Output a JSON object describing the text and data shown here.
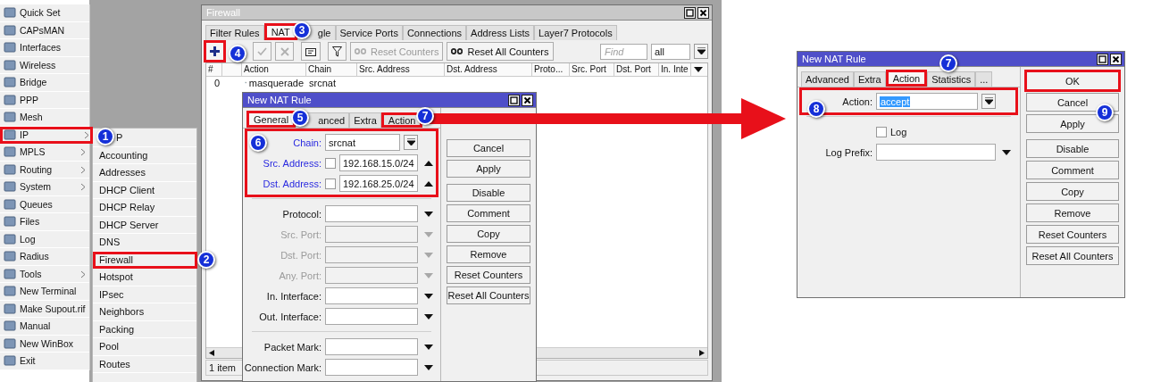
{
  "menu": {
    "items": [
      {
        "label": "Quick Set",
        "has_submenu": false,
        "highlighted": false
      },
      {
        "label": "CAPsMAN",
        "has_submenu": false,
        "highlighted": false
      },
      {
        "label": "Interfaces",
        "has_submenu": false,
        "highlighted": false
      },
      {
        "label": "Wireless",
        "has_submenu": false,
        "highlighted": false
      },
      {
        "label": "Bridge",
        "has_submenu": false,
        "highlighted": false
      },
      {
        "label": "PPP",
        "has_submenu": false,
        "highlighted": false
      },
      {
        "label": "Mesh",
        "has_submenu": false,
        "highlighted": false
      },
      {
        "label": "IP",
        "has_submenu": true,
        "highlighted": true
      },
      {
        "label": "MPLS",
        "has_submenu": true,
        "highlighted": false
      },
      {
        "label": "Routing",
        "has_submenu": true,
        "highlighted": false
      },
      {
        "label": "System",
        "has_submenu": true,
        "highlighted": false
      },
      {
        "label": "Queues",
        "has_submenu": false,
        "highlighted": false
      },
      {
        "label": "Files",
        "has_submenu": false,
        "highlighted": false
      },
      {
        "label": "Log",
        "has_submenu": false,
        "highlighted": false
      },
      {
        "label": "Radius",
        "has_submenu": false,
        "highlighted": false
      },
      {
        "label": "Tools",
        "has_submenu": true,
        "highlighted": false
      },
      {
        "label": "New Terminal",
        "has_submenu": false,
        "highlighted": false
      },
      {
        "label": "Make Supout.rif",
        "has_submenu": false,
        "highlighted": false
      },
      {
        "label": "Manual",
        "has_submenu": false,
        "highlighted": false
      },
      {
        "label": "New WinBox",
        "has_submenu": false,
        "highlighted": false
      },
      {
        "label": "Exit",
        "has_submenu": false,
        "highlighted": false
      }
    ]
  },
  "submenu": {
    "items": [
      {
        "label": "P",
        "highlighted": false
      },
      {
        "label": "Accounting",
        "highlighted": false
      },
      {
        "label": "Addresses",
        "highlighted": false
      },
      {
        "label": "DHCP Client",
        "highlighted": false
      },
      {
        "label": "DHCP Relay",
        "highlighted": false
      },
      {
        "label": "DHCP Server",
        "highlighted": false
      },
      {
        "label": "DNS",
        "highlighted": false
      },
      {
        "label": "Firewall",
        "highlighted": true
      },
      {
        "label": "Hotspot",
        "highlighted": false
      },
      {
        "label": "IPsec",
        "highlighted": false
      },
      {
        "label": "Neighbors",
        "highlighted": false
      },
      {
        "label": "Packing",
        "highlighted": false
      },
      {
        "label": "Pool",
        "highlighted": false
      },
      {
        "label": "Routes",
        "highlighted": false
      }
    ]
  },
  "firewall": {
    "title": "Firewall",
    "tabs": [
      {
        "label": "Filter Rules",
        "selected": false,
        "highlighted": false
      },
      {
        "label": "NAT",
        "selected": true,
        "highlighted": true
      },
      {
        "label": "gle",
        "selected": false,
        "highlighted": false
      },
      {
        "label": "Service Ports",
        "selected": false,
        "highlighted": false
      },
      {
        "label": "Connections",
        "selected": false,
        "highlighted": false
      },
      {
        "label": "Address Lists",
        "selected": false,
        "highlighted": false
      },
      {
        "label": "Layer7 Protocols",
        "selected": false,
        "highlighted": false
      }
    ],
    "toolbar": [
      {
        "kind": "add",
        "disabled": false,
        "highlighted": true
      },
      {
        "kind": "enable",
        "disabled": true,
        "highlighted": false
      },
      {
        "kind": "disable",
        "disabled": true,
        "highlighted": false
      },
      {
        "kind": "comment",
        "disabled": false,
        "highlighted": false
      },
      {
        "kind": "filter",
        "disabled": false,
        "highlighted": false
      },
      {
        "kind": "text",
        "label": "Reset Counters",
        "disabled": true,
        "highlighted": false
      },
      {
        "kind": "text",
        "label": "Reset All Counters",
        "disabled": false,
        "highlighted": false
      }
    ],
    "find": {
      "placeholder": "Find"
    },
    "filter_select": {
      "value": "all"
    },
    "table": {
      "columns": [
        "#",
        "Action",
        "Chain",
        "Src. Address",
        "Dst. Address",
        "Proto...",
        "Src. Port",
        "Dst. Port",
        "In. Inte"
      ],
      "rows": [
        {
          "number": "0",
          "action": "masquerade",
          "chain": "srcnat"
        }
      ]
    },
    "status": "1 item"
  },
  "nat_dialog": {
    "title": "New NAT Rule",
    "tabs": [
      {
        "label": "General",
        "selected": true,
        "highlighted": true
      },
      {
        "label": "anced",
        "selected": false,
        "highlighted": false
      },
      {
        "label": "Extra",
        "selected": false,
        "highlighted": false
      },
      {
        "label": "Action",
        "selected": false,
        "highlighted": true
      }
    ],
    "groups": [
      {
        "highlighted": true,
        "fields": [
          {
            "kind": "select",
            "label": "Chain:",
            "value": "srcnat",
            "set": true,
            "disabled": false
          },
          {
            "kind": "address",
            "label": "Src. Address:",
            "value": "192.168.15.0/24",
            "checked": false,
            "set": true,
            "disabled": false
          },
          {
            "kind": "address",
            "label": "Dst. Address:",
            "value": "192.168.25.0/24",
            "checked": false,
            "set": true,
            "disabled": false
          }
        ]
      },
      {
        "highlighted": false,
        "fields": [
          {
            "kind": "combo",
            "label": "Protocol:",
            "set": false,
            "disabled": false
          },
          {
            "kind": "combo",
            "label": "Src. Port:",
            "set": false,
            "disabled": true
          },
          {
            "kind": "combo",
            "label": "Dst. Port:",
            "set": false,
            "disabled": true
          },
          {
            "kind": "combo",
            "label": "Any. Port:",
            "set": false,
            "disabled": true
          },
          {
            "kind": "combo",
            "label": "In. Interface:",
            "set": false,
            "disabled": false
          },
          {
            "kind": "combo",
            "label": "Out. Interface:",
            "set": false,
            "disabled": false
          }
        ]
      },
      {
        "highlighted": false,
        "fields": [
          {
            "kind": "combo",
            "label": "Packet Mark:",
            "set": false,
            "disabled": false
          },
          {
            "kind": "combo",
            "label": "Connection Mark:",
            "set": false,
            "disabled": false
          }
        ]
      }
    ],
    "button_groups": [
      [
        {
          "label": "Cancel",
          "highlighted": false
        },
        {
          "label": "Apply",
          "highlighted": false
        }
      ],
      [
        {
          "label": "Disable",
          "highlighted": false
        },
        {
          "label": "Comment",
          "highlighted": false
        },
        {
          "label": "Copy",
          "highlighted": false
        },
        {
          "label": "Remove",
          "highlighted": false
        },
        {
          "label": "Reset Counters",
          "highlighted": false
        },
        {
          "label": "Reset All Counters",
          "highlighted": false
        }
      ]
    ]
  },
  "action_dialog": {
    "title": "New NAT Rule",
    "tabs": [
      {
        "label": "Advanced",
        "selected": false,
        "highlighted": false
      },
      {
        "label": "Extra",
        "selected": false,
        "highlighted": false
      },
      {
        "label": "Action",
        "selected": true,
        "highlighted": true
      },
      {
        "label": "Statistics",
        "selected": false,
        "highlighted": false
      },
      {
        "label": "...",
        "selected": false,
        "highlighted": false
      }
    ],
    "groups": [
      {
        "highlighted": true,
        "fields": [
          {
            "kind": "select",
            "label": "Action:",
            "value": "accept",
            "value_selected": true
          }
        ]
      },
      {
        "highlighted": false,
        "fields": [
          {
            "kind": "checkbox",
            "label": "Log",
            "checked": false
          },
          {
            "kind": "combo",
            "label": "Log Prefix:"
          }
        ]
      }
    ],
    "button_groups": [
      [
        {
          "label": "OK",
          "highlighted": true
        },
        {
          "label": "Cancel",
          "highlighted": false
        },
        {
          "label": "Apply",
          "highlighted": false
        }
      ],
      [
        {
          "label": "Disable",
          "highlighted": false
        },
        {
          "label": "Comment",
          "highlighted": false
        },
        {
          "label": "Copy",
          "highlighted": false
        },
        {
          "label": "Remove",
          "highlighted": false
        },
        {
          "label": "Reset Counters",
          "highlighted": false
        },
        {
          "label": "Reset All Counters",
          "highlighted": false
        }
      ]
    ]
  },
  "callouts": [
    {
      "number": "1"
    },
    {
      "number": "2"
    },
    {
      "number": "3"
    },
    {
      "number": "4"
    },
    {
      "number": "5"
    },
    {
      "number": "6"
    },
    {
      "number": "7"
    },
    {
      "number": "7"
    },
    {
      "number": "8"
    },
    {
      "number": "9"
    }
  ]
}
